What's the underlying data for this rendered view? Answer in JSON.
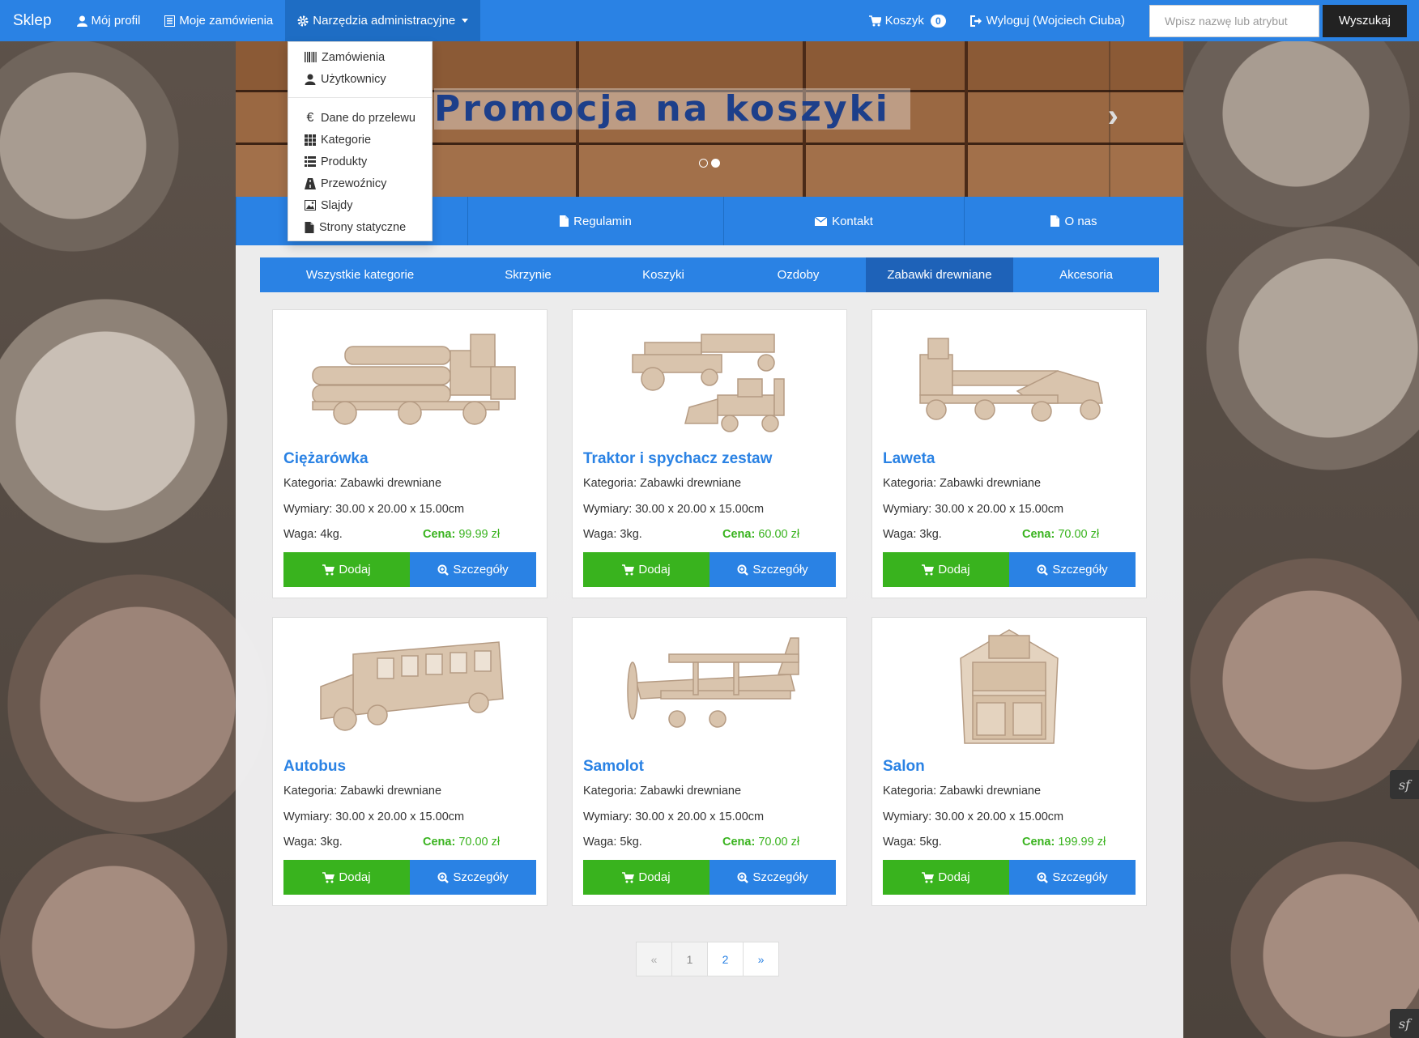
{
  "navbar": {
    "brand": "Sklep",
    "my_profile": "Mój profil",
    "my_orders": "Moje zamówienia",
    "admin_tools": "Narzędzia administracyjne",
    "cart_label": "Koszyk",
    "cart_count": "0",
    "logout": "Wyloguj (Wojciech Ciuba)",
    "search_placeholder": "Wpisz nazwę lub atrybut",
    "search_button": "Wyszukaj"
  },
  "dropdown": {
    "items": [
      {
        "label": "Zamówienia",
        "icon": "barcode-icon"
      },
      {
        "label": "Użytkownicy",
        "icon": "user-icon"
      },
      {
        "label": "Dane do przelewu",
        "icon": "euro-icon"
      },
      {
        "label": "Kategorie",
        "icon": "grid-icon"
      },
      {
        "label": "Produkty",
        "icon": "list-icon"
      },
      {
        "label": "Przewoźnicy",
        "icon": "road-icon"
      },
      {
        "label": "Slajdy",
        "icon": "picture-icon"
      },
      {
        "label": "Strony statyczne",
        "icon": "file-icon"
      }
    ]
  },
  "carousel": {
    "title": "Promocja na koszyki",
    "next_arrow": "›"
  },
  "page_menu": {
    "items": [
      "Regulamin",
      "Kontakt",
      "O nas"
    ]
  },
  "categories": {
    "tabs": [
      "Wszystkie kategorie",
      "Skrzynie",
      "Koszyki",
      "Ozdoby",
      "Zabawki drewniane",
      "Akcesoria"
    ],
    "active": "Zabawki drewniane"
  },
  "product_labels": {
    "category_prefix": "Kategoria:",
    "dimensions_prefix": "Wymiary:",
    "weight_prefix": "Waga:",
    "price_prefix": "Cena:",
    "add_button": "Dodaj",
    "details_button": "Szczegóły"
  },
  "products": [
    {
      "name": "Ciężarówka",
      "category": "Kategoria: Zabawki drewniane",
      "dimensions": "Wymiary: 30.00 x 20.00 x 15.00cm",
      "weight": "Waga: 4kg.",
      "price": "99.99 zł"
    },
    {
      "name": "Traktor i spychacz zestaw",
      "category": "Kategoria: Zabawki drewniane",
      "dimensions": "Wymiary: 30.00 x 20.00 x 15.00cm",
      "weight": "Waga: 3kg.",
      "price": "60.00 zł"
    },
    {
      "name": "Laweta",
      "category": "Kategoria: Zabawki drewniane",
      "dimensions": "Wymiary: 30.00 x 20.00 x 15.00cm",
      "weight": "Waga: 3kg.",
      "price": "70.00 zł"
    },
    {
      "name": "Autobus",
      "category": "Kategoria: Zabawki drewniane",
      "dimensions": "Wymiary: 30.00 x 20.00 x 15.00cm",
      "weight": "Waga: 3kg.",
      "price": "70.00 zł"
    },
    {
      "name": "Samolot",
      "category": "Kategoria: Zabawki drewniane",
      "dimensions": "Wymiary: 30.00 x 20.00 x 15.00cm",
      "weight": "Waga: 5kg.",
      "price": "70.00 zł"
    },
    {
      "name": "Salon",
      "category": "Kategoria: Zabawki drewniane",
      "dimensions": "Wymiary: 30.00 x 20.00 x 15.00cm",
      "weight": "Waga: 5kg.",
      "price": "199.99 zł"
    }
  ],
  "pagination": {
    "prev": "«",
    "pages": [
      "1",
      "2"
    ],
    "current": "1",
    "next": "»"
  },
  "colors": {
    "primary": "#2a82e4",
    "success": "#39b31e",
    "dark": "#222222"
  }
}
